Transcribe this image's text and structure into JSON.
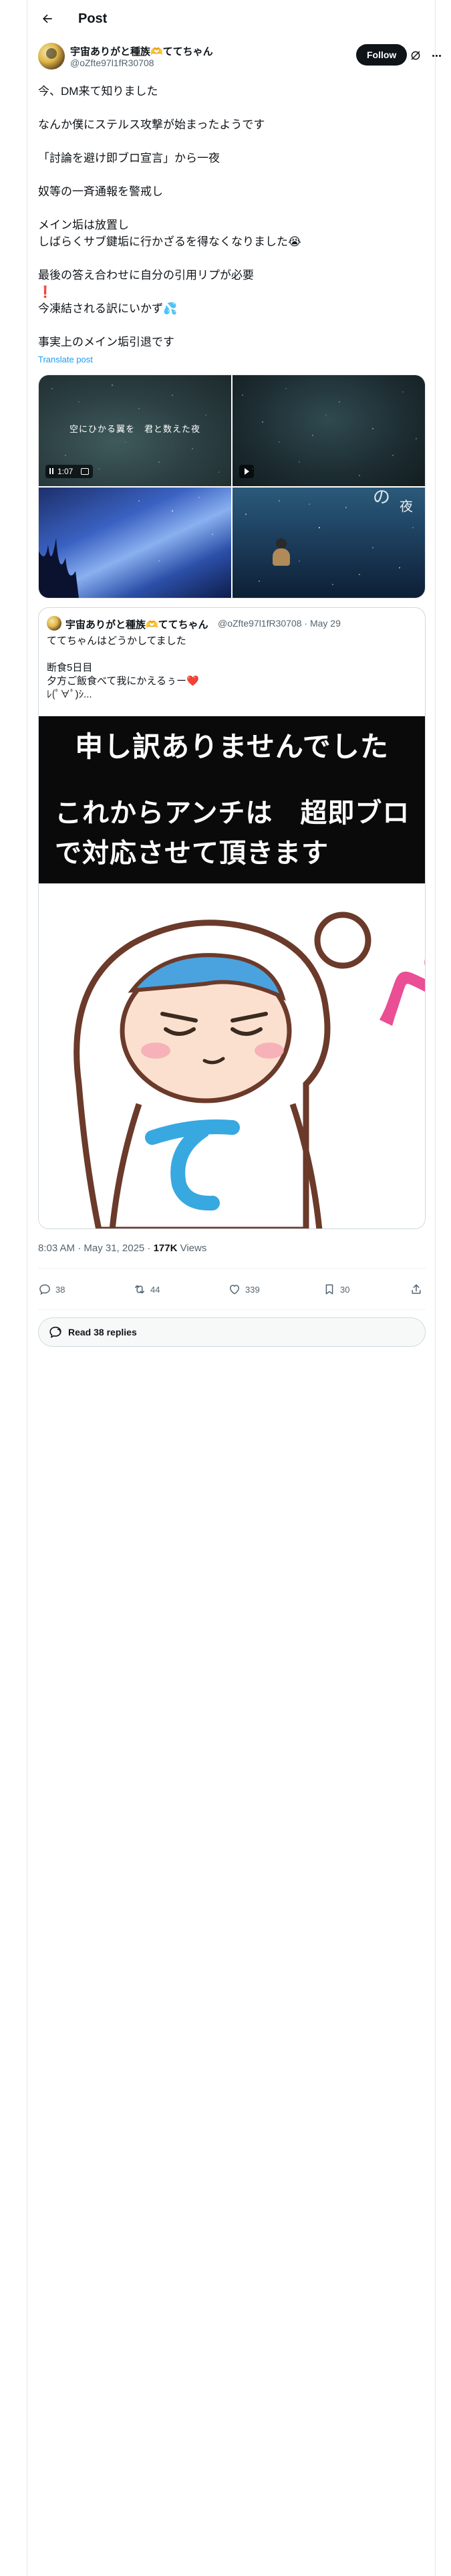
{
  "header": {
    "title": "Post"
  },
  "author": {
    "name": "宇宙ありがと種族🫶ててちゃん",
    "handle": "@oZfte97l1fR30708",
    "follow_label": "Follow"
  },
  "post": {
    "lines": [
      "今、DM来て知りました",
      "なんか僕にステルス攻撃が始まったようです",
      "「討論を避け即ブロ宣言」から一夜",
      "奴等の一斉通報を警戒し",
      "メイン垢は放置し",
      "しばらくサブ鍵垢に行かざるを得なくなりました😭",
      "最後の答え合わせに自分の引用リプが必要",
      "❗",
      "今凍結される訳にいかず💦",
      "事実上のメイン垢引退です"
    ],
    "translate_label": "Translate post"
  },
  "media": {
    "caption1": "空にひかる翼を　君と数えた夜",
    "duration": "1:07",
    "night_char": "夜",
    "night_char2": "の"
  },
  "quote": {
    "name": "宇宙ありがと種族🫶ててちゃん",
    "handle_date": "@oZfte97l1fR30708 · May 29",
    "line1": "ててちゃんはどうかしてました",
    "line2": "断食5日目",
    "line3": "夕方ご飯食べて我にかえるぅー❤️",
    "line4": "ﾚ(ﾟ∀ﾟ)ｼ...",
    "image_line1": "申し訳ありませんでした",
    "image_line2": "これからアンチは　超即ブロ",
    "image_line3": "で対応させて頂きます",
    "image_pe": "ペコ",
    "image_te": "て"
  },
  "meta": {
    "time_date": "8:03 AM · May 31, 2025 · ",
    "views_count": "177K",
    "views_label": " Views"
  },
  "actions": {
    "replies": "38",
    "reposts": "44",
    "likes": "339",
    "bookmarks": "30"
  },
  "read_replies_label": "Read 38 replies",
  "colors": {
    "accent": "#1d9bf0",
    "text": "#0f1419",
    "secondary": "#536471",
    "pink": "#ea4e94"
  },
  "icons": [
    "back-arrow-icon",
    "grok-icon",
    "more-icon",
    "reply-icon",
    "retweet-icon",
    "heart-icon",
    "bookmark-icon",
    "share-icon",
    "speech-bubble-icon"
  ]
}
